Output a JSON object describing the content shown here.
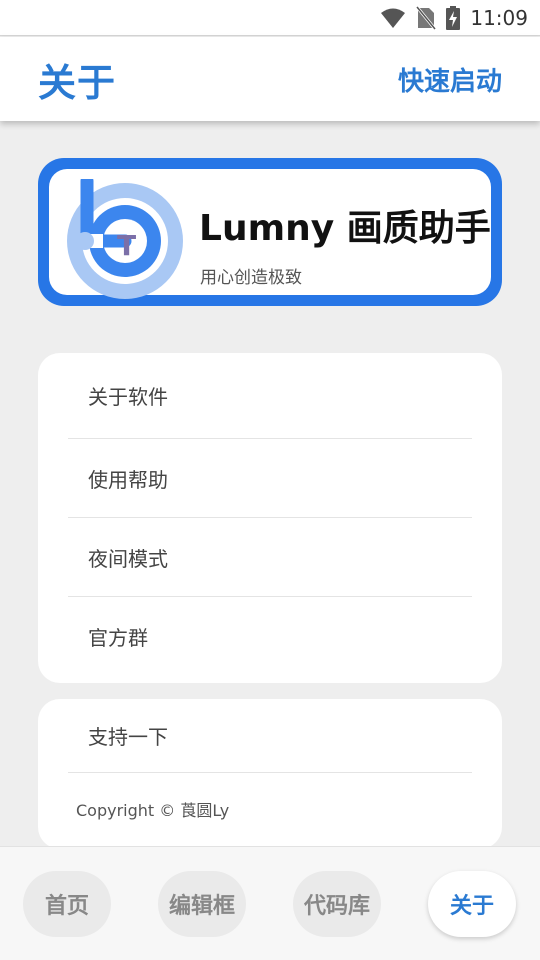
{
  "status_bar": {
    "time": "11:09",
    "icons": [
      "wifi-icon",
      "no-sim-icon",
      "battery-charging-icon"
    ]
  },
  "app_bar": {
    "title": "关于",
    "action_label": "快速启动"
  },
  "header": {
    "logo_letters": "T",
    "title": "Lumny 画质助手",
    "subtitle": "用心创造极致"
  },
  "menu": {
    "items": [
      {
        "label": "关于软件"
      },
      {
        "label": "使用帮助"
      },
      {
        "label": "夜间模式"
      },
      {
        "label": "官方群"
      }
    ]
  },
  "support": {
    "label": "支持一下",
    "copyright": "Copyright © 莨圆Ly"
  },
  "bottom_nav": {
    "tabs": [
      {
        "label": "首页",
        "active": false
      },
      {
        "label": "编辑框",
        "active": false
      },
      {
        "label": "代码库",
        "active": false
      },
      {
        "label": "关于",
        "active": true
      }
    ]
  },
  "colors": {
    "accent": "#2a7ad2",
    "card_border": "#2776e6",
    "background": "#eeeeee"
  }
}
